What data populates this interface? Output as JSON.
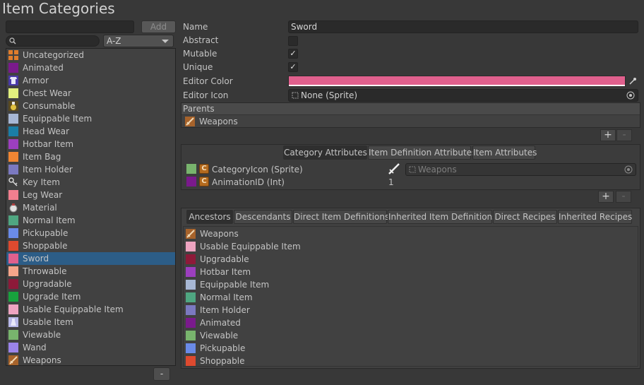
{
  "window": {
    "title": "Item Categories"
  },
  "toolbar": {
    "add_label": "Add",
    "sort_value": "A-Z",
    "search_value": "",
    "name_filter_value": ""
  },
  "categories": [
    {
      "label": "Uncategorized",
      "color": "#e07d2c",
      "icon": "grid-icon"
    },
    {
      "label": "Animated",
      "color": "#7a1a8c"
    },
    {
      "label": "Armor",
      "color": "#6666cc",
      "icon": "armor-icon"
    },
    {
      "label": "Chest Wear",
      "color": "#e1ef7e"
    },
    {
      "label": "Consumable",
      "color": "#b8a22a",
      "icon": "potion-icon"
    },
    {
      "label": "Equippable Item",
      "color": "#a7b7d4"
    },
    {
      "label": "Head Wear",
      "color": "#1b7ea7"
    },
    {
      "label": "Hotbar Item",
      "color": "#9c3fbf"
    },
    {
      "label": "Item Bag",
      "color": "#f08633"
    },
    {
      "label": "Item Holder",
      "color": "#7b79c0"
    },
    {
      "label": "Key Item",
      "color": "#d9d9d9",
      "icon": "key-icon"
    },
    {
      "label": "Leg Wear",
      "color": "#f17f8f"
    },
    {
      "label": "Material",
      "color": "#d9d9d9",
      "icon": "material-icon"
    },
    {
      "label": "Normal Item",
      "color": "#4fa681"
    },
    {
      "label": "Pickupable",
      "color": "#6a8be8"
    },
    {
      "label": "Shoppable",
      "color": "#de4a2f"
    },
    {
      "label": "Sword",
      "color": "#e0608d",
      "selected": true
    },
    {
      "label": "Throwable",
      "color": "#f5a58a"
    },
    {
      "label": "Upgradable",
      "color": "#8d1a39"
    },
    {
      "label": "Upgrade Item",
      "color": "#18a23d"
    },
    {
      "label": "Usable Equippable Item",
      "color": "#eea4c1"
    },
    {
      "label": "Usable Item",
      "color": "#b8b8e8",
      "icon": "usable-icon"
    },
    {
      "label": "Viewable",
      "color": "#78b46d"
    },
    {
      "label": "Wand",
      "color": "#9b84ea"
    },
    {
      "label": "Weapons",
      "color": "#a7632b",
      "icon": "sword-icon"
    }
  ],
  "remove_label": "-",
  "properties": {
    "name_label": "Name",
    "name_value": "Sword",
    "abstract_label": "Abstract",
    "abstract_checked": false,
    "mutable_label": "Mutable",
    "mutable_checked": true,
    "unique_label": "Unique",
    "unique_checked": true,
    "editor_color_label": "Editor Color",
    "editor_color_value": "#e0608d",
    "editor_icon_label": "Editor Icon",
    "editor_icon_value": "None (Sprite)"
  },
  "parents": {
    "header": "Parents",
    "items": [
      {
        "label": "Weapons",
        "icon": "sword-icon"
      }
    ]
  },
  "attr_tabs": [
    "Category Attributes",
    "Item Definition Attributes",
    "Item Attributes"
  ],
  "attributes": [
    {
      "name": "CategoryIcon (Sprite)",
      "color": "#78b46d",
      "type_letter": "C",
      "value": "Weapons",
      "value_kind": "sprite"
    },
    {
      "name": "AnimationID (Int)",
      "color": "#7a1a8c",
      "type_letter": "C",
      "value": "1",
      "value_kind": "int"
    }
  ],
  "relation_tabs": [
    "Ancestors",
    "Descendants",
    "Direct Item Definitions",
    "Inherited Item Definitions",
    "Direct Recipes",
    "Inherited Recipes"
  ],
  "ancestors": [
    {
      "label": "Weapons",
      "color": "#a7632b",
      "icon": "sword-icon"
    },
    {
      "label": "Usable Equippable Item",
      "color": "#eea4c1"
    },
    {
      "label": "Upgradable",
      "color": "#8d1a39"
    },
    {
      "label": "Hotbar Item",
      "color": "#9c3fbf"
    },
    {
      "label": "Equippable Item",
      "color": "#a7b7d4"
    },
    {
      "label": "Normal Item",
      "color": "#4fa681"
    },
    {
      "label": "Item Holder",
      "color": "#7b79c0"
    },
    {
      "label": "Animated",
      "color": "#7a1a8c"
    },
    {
      "label": "Viewable",
      "color": "#78b46d"
    },
    {
      "label": "Pickupable",
      "color": "#6a8be8"
    },
    {
      "label": "Shoppable",
      "color": "#de4a2f"
    }
  ],
  "plus_label": "+",
  "minus_label": "-"
}
